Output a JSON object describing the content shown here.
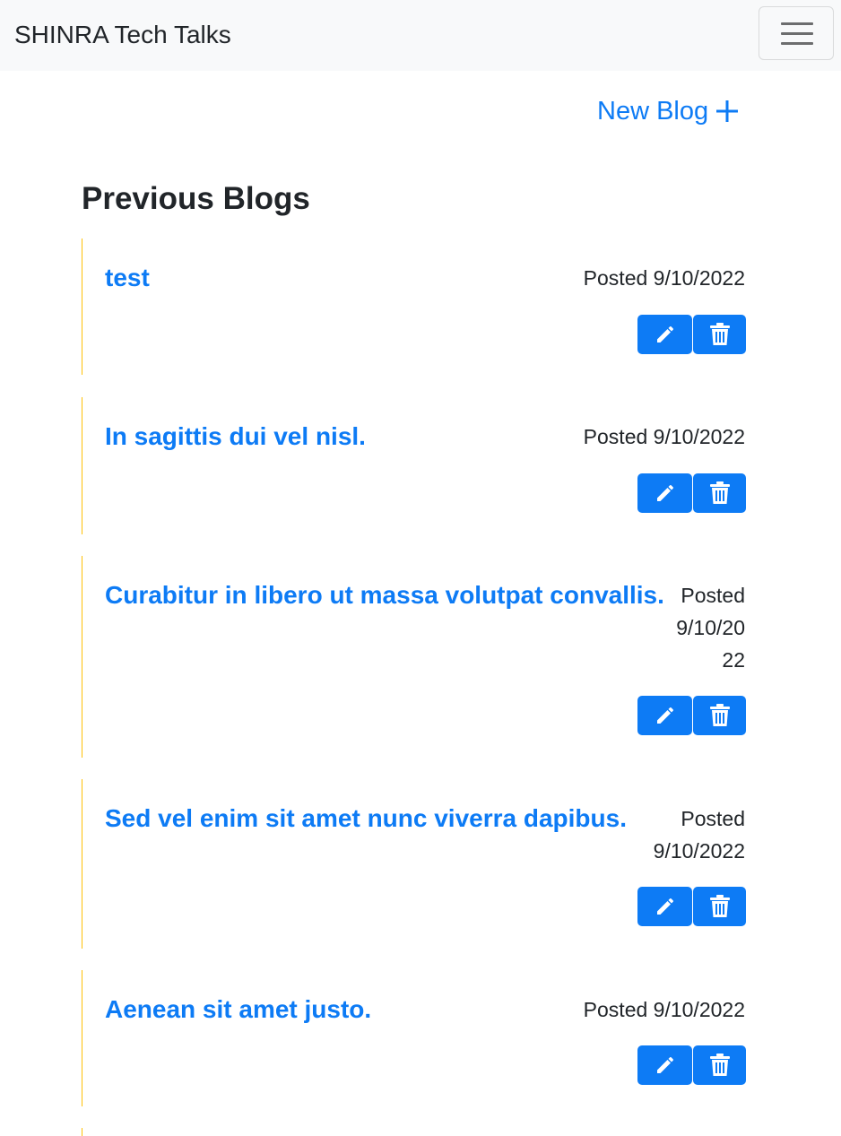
{
  "navbar": {
    "brand": "SHINRA Tech Talks",
    "toggler_icon": "hamburger-icon"
  },
  "new_blog": {
    "label": "New Blog",
    "icon": "plus-icon"
  },
  "section_title": "Previous Blogs",
  "blogs": [
    {
      "title": "test",
      "posted": "Posted 9/10/2022"
    },
    {
      "title": "In sagittis dui vel nisl.",
      "posted": "Posted 9/10/2022"
    },
    {
      "title": "Curabitur in libero ut massa volutpat convallis.",
      "posted_lines": [
        "Posted",
        "9/10/20",
        "22"
      ]
    },
    {
      "title": "Sed vel enim sit amet nunc viverra dapibus.",
      "posted_lines": [
        "Posted",
        "9/10/2022"
      ]
    },
    {
      "title": "Aenean sit amet justo.",
      "posted": "Posted 9/10/2022"
    }
  ],
  "actions": {
    "edit_icon": "pencil-icon",
    "delete_icon": "trash-icon"
  },
  "colors": {
    "accent": "#0d7bf5",
    "card_border": "#ffc107",
    "navbar_bg": "#f8f9fa",
    "text": "#212529"
  }
}
